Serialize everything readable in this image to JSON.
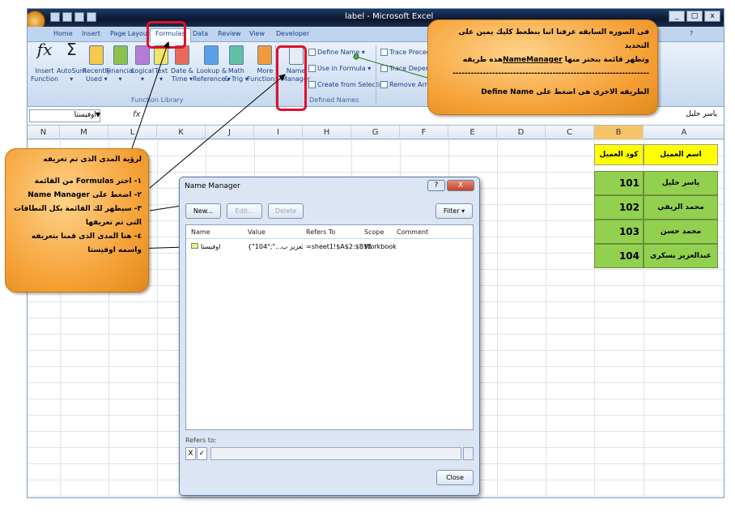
{
  "window": {
    "title": "label - Microsoft Excel",
    "min": "_",
    "max": "□",
    "close": "x"
  },
  "tabs": [
    "Home",
    "Insert",
    "Page Layout",
    "Formulas",
    "Data",
    "Review",
    "View",
    "Developer"
  ],
  "help_label": "?",
  "ribbon": {
    "insert_function": [
      "Insert",
      "Function"
    ],
    "autosum": [
      "AutoSum",
      "▾"
    ],
    "recently_used": [
      "Recently",
      "Used ▾"
    ],
    "financial": [
      "Financial",
      "▾"
    ],
    "logical": [
      "Logical",
      "▾"
    ],
    "text": [
      "Text",
      "▾"
    ],
    "date_time": [
      "Date &",
      "Time ▾"
    ],
    "lookup": [
      "Lookup &",
      "Reference ▾"
    ],
    "math": [
      "Math",
      "& Trig ▾"
    ],
    "more": [
      "More",
      "Functions ▾"
    ],
    "group_function_library": "Function Library",
    "name_manager": [
      "Name",
      "Manager"
    ],
    "define_name": "Define Name ▾",
    "use_in_formula": "Use in Formula ▾",
    "create_from_selection": "Create from Selection",
    "group_defined_names": "Defined Names",
    "trace_precedents": "Trace Preceden",
    "trace_dependents": "Trace Depende",
    "remove_arrows": "Remove Arrows"
  },
  "formula_bar": {
    "name_box": "اوفيستا",
    "fx": "fx",
    "value": "ياسر خليل"
  },
  "columns": [
    "N",
    "M",
    "L",
    "K",
    "J",
    "I",
    "H",
    "G",
    "F",
    "E",
    "D",
    "C",
    "B",
    "A"
  ],
  "sheet": {
    "header_a": "اسم العميل",
    "header_b": "كود العميل",
    "rows": [
      {
        "name": "ياسر خليل",
        "code": "101"
      },
      {
        "name": "محمد الريفي",
        "code": "102"
      },
      {
        "name": "محمد حسن",
        "code": "103"
      },
      {
        "name": "عبدالعزيز بسكرى",
        "code": "104"
      }
    ]
  },
  "callout_top": {
    "line1": "فى الصوره السابقه عرفنا اننا بنظغط كليك يمين على التحديد",
    "line2": "وتظهر قائمة بنختر منها",
    "line2_key": "NameManager",
    "line2_end": "هذه طريقه",
    "divider": "-----------------------------------------------------------------",
    "line3": "الطريقه الاخرى هى اضغط على",
    "line3_key": "Define Name"
  },
  "callout_left": {
    "line0": "لرؤية المدى الذى تم تعريفه",
    "line1": "١- اختر Formulas من القائمة",
    "line2": "٢- اضغط على Name Manager",
    "line3": "٣- سيظهر لك القائمة بكل النطاقات",
    "line4": "التى تم تعريفها",
    "line5": "٤- هنا المدى الذى قمنا بتعريفه",
    "line6": "واسمه اوفيستا"
  },
  "dialog": {
    "title": "Name Manager",
    "help": "?",
    "close": "X",
    "new": "New...",
    "edit": "Edit...",
    "delete": "Delete",
    "filter": "Filter ▾",
    "headers": [
      "Name",
      "Value",
      "Refers To",
      "Scope",
      "Comment"
    ],
    "row": {
      "name": "اوفيستا",
      "value": "{\"104\";\"...عبدالعزيز ب",
      "refers_to": "=sheet1!$A$2:$B$5",
      "scope": "Workbook",
      "comment": ""
    },
    "refers_label": "Refers to:",
    "cancel_sym": "X",
    "ok_sym": "✓",
    "close_btn": "Close"
  },
  "colors": {
    "accent_red": "#e0102a",
    "callout": "#f5a035",
    "header_yellow": "#ffff00",
    "data_green": "#92d050"
  }
}
